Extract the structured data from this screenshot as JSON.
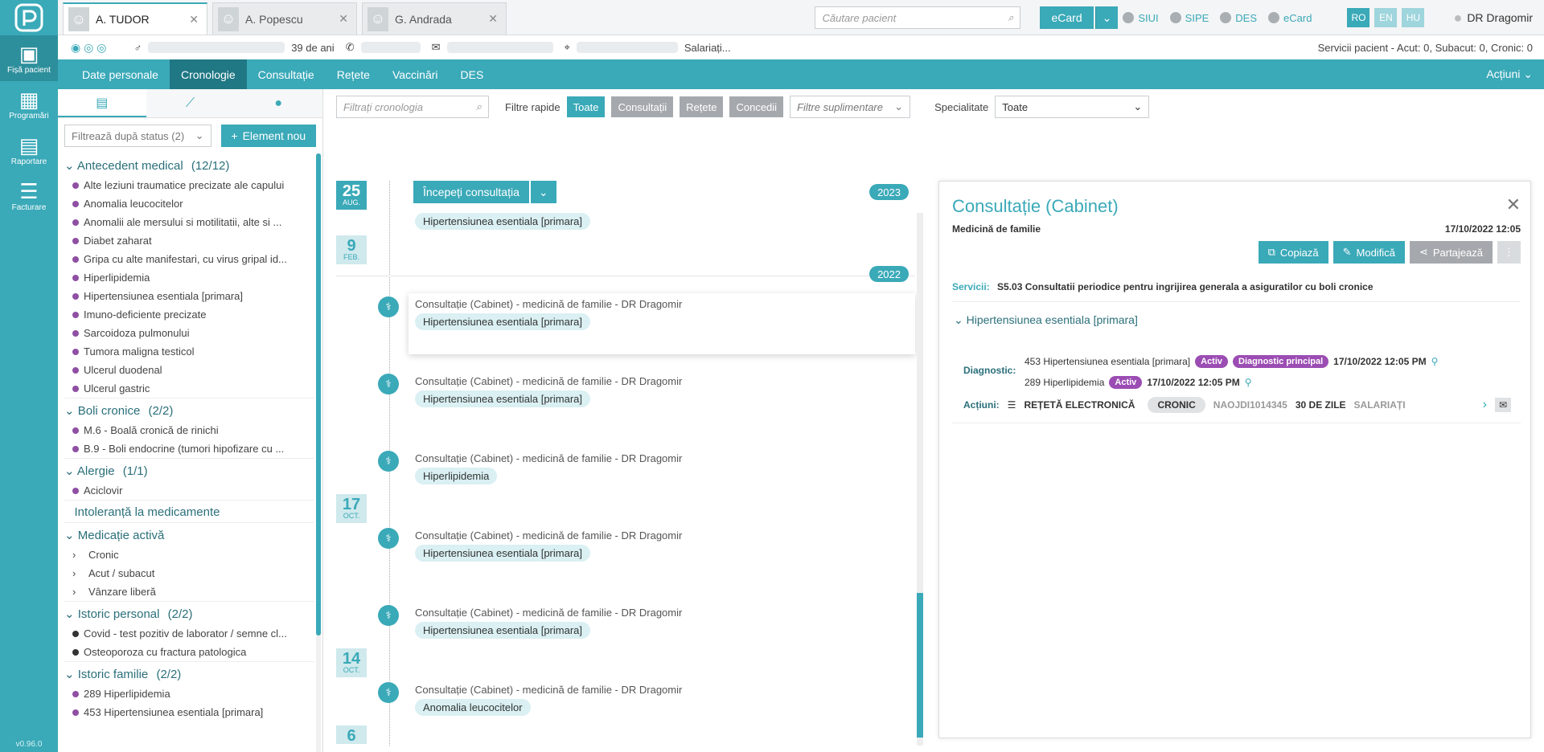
{
  "rail": {
    "items": [
      {
        "label": "Fișă pacient",
        "icon": "user-card-icon"
      },
      {
        "label": "Programări",
        "icon": "grid-icon"
      },
      {
        "label": "Raportare",
        "icon": "document-icon"
      },
      {
        "label": "Facturare",
        "icon": "invoice-icon"
      }
    ],
    "version": "v0.96.0"
  },
  "tabs": [
    {
      "label": "A. TUDOR"
    },
    {
      "label": "A. Popescu"
    },
    {
      "label": "G. Andrada"
    }
  ],
  "top": {
    "search_placeholder": "Căutare pacient",
    "ecard": "eCard",
    "services": [
      "SIUI",
      "SIPE",
      "DES",
      "eCard"
    ],
    "langs": [
      "RO",
      "EN",
      "HU"
    ],
    "user": "DR Dragomir"
  },
  "info": {
    "age": "39 de ani",
    "occupation": "Salariați...",
    "services_summary": "Servicii pacient - Acut: 0, Subacut: 0, Cronic: 0"
  },
  "nav": {
    "items": [
      "Date personale",
      "Cronologie",
      "Consultație",
      "Rețete",
      "Vaccinări",
      "DES"
    ],
    "actions": "Acțiuni"
  },
  "left": {
    "filter": "Filtrează după status (2)",
    "new_button": "Element nou",
    "sections": [
      {
        "title": "Antecedent medical",
        "count": "(12/12)",
        "items": [
          "Alte leziuni traumatice precizate ale capului",
          "Anomalia leucocitelor",
          "Anomalii ale mersului si motilitatii, alte si ...",
          "Diabet zaharat",
          "Gripa cu alte manifestari, cu virus gripal id...",
          "Hiperlipidemia",
          "Hipertensiunea esentiala [primara]",
          "Imuno-deficiente precizate",
          "Sarcoidoza pulmonului",
          "Tumora maligna testicol",
          "Ulcerul duodenal",
          "Ulcerul gastric"
        ]
      },
      {
        "title": "Boli cronice",
        "count": "(2/2)",
        "items": [
          "M.6 - Boală cronică de rinichi",
          "B.9 - Boli endocrine (tumori hipofizare cu ..."
        ]
      },
      {
        "title": "Alergie",
        "count": "(1/1)",
        "items": [
          "Aciclovir"
        ]
      },
      {
        "title": "Intoleranță la medicamente",
        "count": "",
        "items": []
      },
      {
        "title": "Medicație activă",
        "count": "",
        "items": [
          "Cronic",
          "Acut / subacut",
          "Vânzare liberă"
        ]
      },
      {
        "title": "Istoric personal",
        "count": "(2/2)",
        "items": [
          "Covid - test pozitiv de laborator / semne cl...",
          "Osteoporoza cu fractura patologica"
        ]
      },
      {
        "title": "Istoric familie",
        "count": "(2/2)",
        "items": [
          "289 Hiperlipidemia",
          "453 Hipertensiunea esentiala [primara]"
        ]
      }
    ]
  },
  "filters": {
    "search_placeholder": "Filtrați cronologia",
    "quick_label": "Filtre rapide",
    "chips": [
      "Toate",
      "Consultații",
      "Rețete",
      "Concedii"
    ],
    "extra_placeholder": "Filtre suplimentare",
    "spec_label": "Specialitate",
    "spec_value": "Toate"
  },
  "timeline": {
    "start": "Începeți consultația",
    "years": [
      "2023",
      "2022"
    ],
    "dates": [
      {
        "d": "25",
        "m": "AUG."
      },
      {
        "d": "9",
        "m": "FEB."
      },
      {
        "d": "17",
        "m": "OCT."
      },
      {
        "d": "14",
        "m": "OCT."
      },
      {
        "d": "6",
        "m": ""
      }
    ],
    "feb_tag": "Hipertensiunea esentiala [primara]",
    "entries": [
      {
        "title": "Consultație (Cabinet) - medicină de familie - DR Dragomir",
        "tag": "Hipertensiunea esentiala [primara]"
      },
      {
        "title": "Consultație (Cabinet) - medicină de familie - DR Dragomir",
        "tag": "Hipertensiunea esentiala [primara]"
      },
      {
        "title": "Consultație (Cabinet) - medicină de familie - DR Dragomir",
        "tag": "Hiperlipidemia"
      },
      {
        "title": "Consultație (Cabinet) - medicină de familie - DR Dragomir",
        "tag": "Hipertensiunea esentiala [primara]"
      },
      {
        "title": "Consultație (Cabinet) - medicină de familie - DR Dragomir",
        "tag": "Hipertensiunea esentiala [primara]"
      },
      {
        "title": "Consultație (Cabinet) - medicină de familie - DR Dragomir",
        "tag": "Anomalia leucocitelor"
      }
    ]
  },
  "panel": {
    "title": "Consultație (Cabinet)",
    "specialty": "Medicină de familie",
    "datetime": "17/10/2022 12:05",
    "buttons": [
      "Copiază",
      "Modifică",
      "Partajează"
    ],
    "services_label": "Servicii:",
    "services_value": "S5.03 Consultatii periodice pentru ingrijirea generala a asiguratilor cu boli cronice",
    "section": "Hipertensiunea esentiala [primara]",
    "diag_label": "Diagnostic:",
    "diag1": "453 Hipertensiunea esentiala [primara]",
    "diag1_status": "Activ",
    "diag1_main": "Diagnostic principal",
    "diag1_date": "17/10/2022 12:05 PM",
    "diag2": "289 Hiperlipidemia",
    "diag2_status": "Activ",
    "diag2_date": "17/10/2022 12:05 PM",
    "act_label": "Acțiuni:",
    "act_rx": "REȚETĂ ELECTRONICĂ",
    "act_type": "CRONIC",
    "act_code": "NAOJDI1014345",
    "act_days": "30 DE ZILE",
    "act_cat": "SALARIAȚI"
  }
}
